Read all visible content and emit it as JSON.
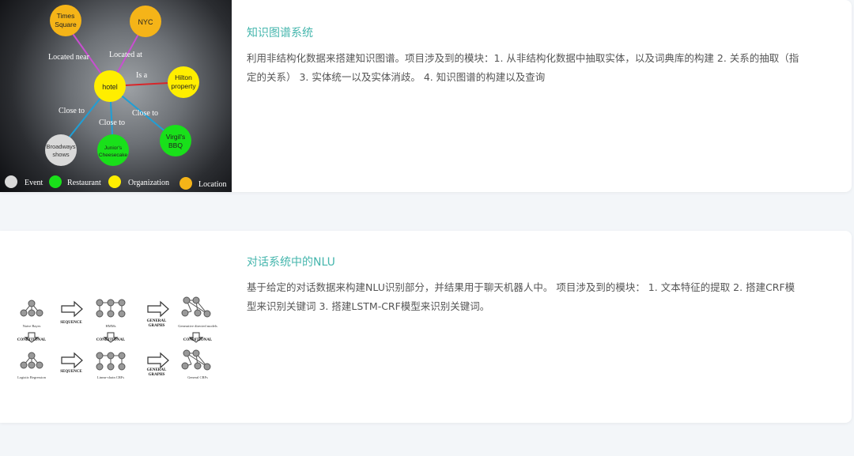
{
  "projects": [
    {
      "title": "知识图谱系统",
      "description": "利用非结构化数据来搭建知识图谱。项目涉及到的模块：1. 从非结构化数据中抽取实体，以及词典库的构建 2. 关系的抽取（指定的关系） 3. 实体统一以及实体消歧。 4. 知识图谱的构建以及查询",
      "image": {
        "nodes": {
          "center": "hotel",
          "times_square_1": "Times",
          "times_square_2": "Square",
          "nyc": "NYC",
          "hilton_1": "Hilton",
          "hilton_2": "property",
          "broadway_1": "Broadways",
          "broadway_2": "shows",
          "juniors_1": "Junior's",
          "juniors_2": "Cheesecake",
          "virgil_1": "Virgil's",
          "virgil_2": "BBQ"
        },
        "edges": {
          "located_near": "Located near",
          "located_at": "Located at",
          "is_a": "Is a",
          "close_to_1": "Close to",
          "close_to_2": "Close to",
          "close_to_3": "Close to"
        },
        "legend": [
          "Event",
          "Restaurant",
          "Organization",
          "Location"
        ],
        "colors": {
          "event": "#d9d9d9",
          "restaurant": "#19e01a",
          "organization": "#ffee00",
          "location": "#f5b418",
          "edge_pink": "#c84fd0",
          "edge_red": "#d8262a",
          "edge_blue": "#1f9fd6"
        }
      }
    },
    {
      "title": "对话系统中的NLU",
      "description": "基于给定的对话数据来构建NLU识别部分，并结果用于聊天机器人中。 项目涉及到的模块： 1. 文本特征的提取 2. 搭建CRF模型来识别关键词 3. 搭建LSTM-CRF模型来识别关键词。",
      "image": {
        "top_labels": [
          "Naive Bayes",
          "HMMs",
          "Generative directed models"
        ],
        "bottom_labels": [
          "Logistic Regression",
          "Linear-chain CRFs",
          "General CRFs"
        ],
        "sequence": "SEQUENCE",
        "general_graphs_1": "GENERAL",
        "general_graphs_2": "GRAPHS",
        "conditional": "CONDITIONAL"
      }
    }
  ],
  "colors": {
    "accent": "#45b6ad",
    "background": "#f3f6f9",
    "card": "#ffffff",
    "text": "#555555"
  }
}
